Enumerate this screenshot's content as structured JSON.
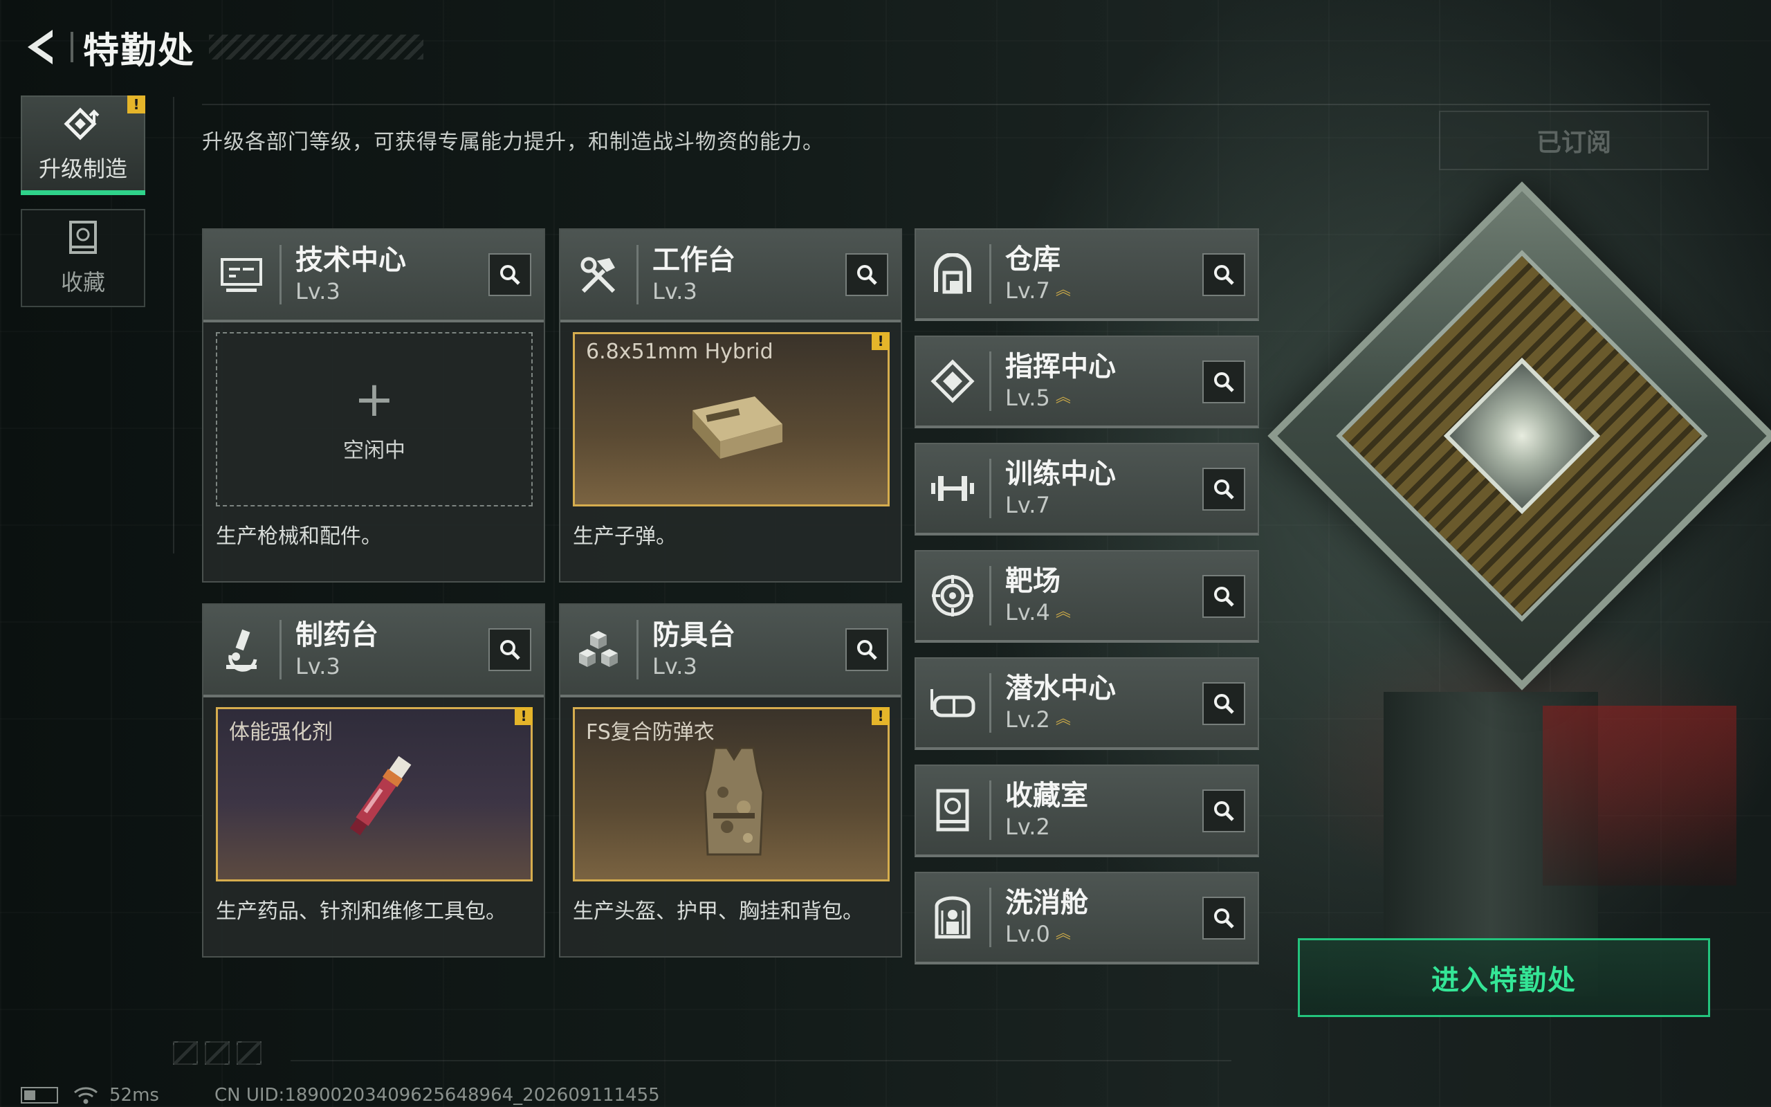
{
  "header": {
    "title": "特勤处"
  },
  "side_tabs": [
    {
      "label": "升级制造",
      "active": true,
      "alert": "!"
    },
    {
      "label": "收藏",
      "active": false
    }
  ],
  "subtitle": "升级各部门等级，可获得专属能力提升，和制造战斗物资的能力。",
  "subscribed_label": "已订阅",
  "facilities": [
    {
      "name": "技术中心",
      "level": "Lv.3",
      "icon": "monitor-icon",
      "slot": {
        "state": "empty",
        "plus": "+",
        "idle_text": "空闲中"
      },
      "description": "生产枪械和配件。"
    },
    {
      "name": "工作台",
      "level": "Lv.3",
      "icon": "hammer-wrench-icon",
      "slot": {
        "state": "filled",
        "item": "6.8x51mm Hybrid",
        "alert": "!",
        "item_icon": "ammo-box-icon"
      },
      "description": "生产子弹。"
    },
    {
      "name": "制药台",
      "level": "Lv.3",
      "icon": "microscope-icon",
      "slot": {
        "state": "filled",
        "item": "体能强化剂",
        "alert": "!",
        "item_icon": "injector-icon"
      },
      "description": "生产药品、针剂和维修工具包。"
    },
    {
      "name": "防具台",
      "level": "Lv.3",
      "icon": "cubes-icon",
      "slot": {
        "state": "filled",
        "item": "FS复合防弹衣",
        "alert": "!",
        "item_icon": "body-armor-icon"
      },
      "description": "生产头盔、护甲、胸挂和背包。"
    }
  ],
  "rooms": [
    {
      "name": "仓库",
      "level": "Lv.7",
      "upgradable": true,
      "icon": "warehouse-icon"
    },
    {
      "name": "指挥中心",
      "level": "Lv.5",
      "upgradable": true,
      "icon": "command-diamond-icon"
    },
    {
      "name": "训练中心",
      "level": "Lv.7",
      "upgradable": false,
      "icon": "dumbbell-icon"
    },
    {
      "name": "靶场",
      "level": "Lv.4",
      "upgradable": true,
      "icon": "target-icon"
    },
    {
      "name": "潜水中心",
      "level": "Lv.2",
      "upgradable": true,
      "icon": "diving-mask-icon"
    },
    {
      "name": "收藏室",
      "level": "Lv.2",
      "upgradable": false,
      "icon": "collection-case-icon"
    },
    {
      "name": "洗消舱",
      "level": "Lv.0",
      "upgradable": true,
      "icon": "decontamination-icon"
    }
  ],
  "upgrade_chevron": "︽",
  "enter_button": "进入特勤处",
  "status": {
    "ping": "52ms",
    "uid": "CN UID:18900203409625648964_202609111455"
  },
  "colors": {
    "accent_green": "#23c47d",
    "alert_yellow": "#e5b52a",
    "gold_border": "#d6ad4e"
  }
}
